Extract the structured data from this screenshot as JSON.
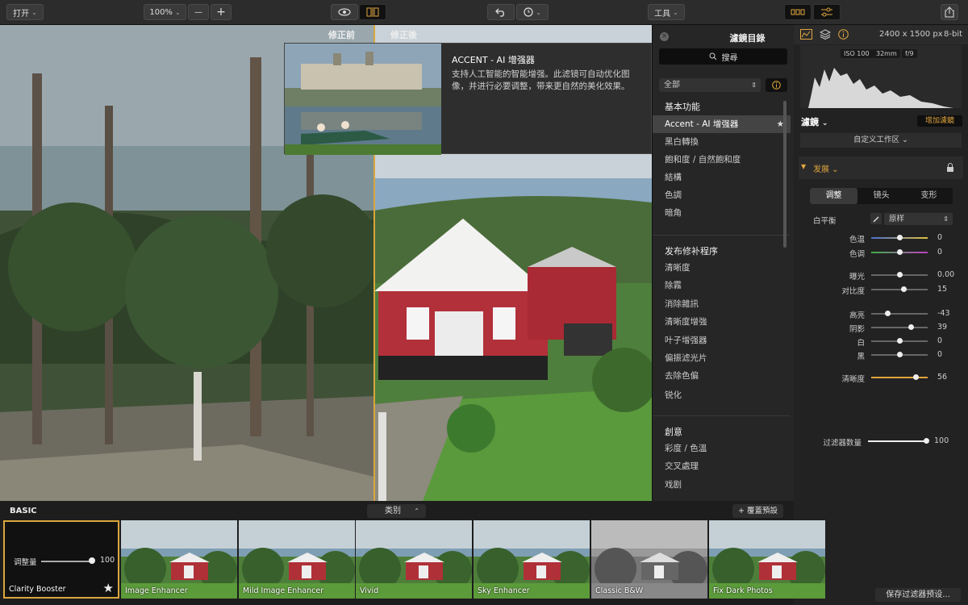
{
  "toolbar": {
    "open_label": "打开",
    "zoom_value": "100%",
    "minus_label": "—",
    "plus_label": "+",
    "tools_label": "工具"
  },
  "compare": {
    "before_label": "修正前",
    "after_label": "修正後"
  },
  "tooltip": {
    "title": "ACCENT - AI 增强器",
    "description": "支持人工智能的智能增强。此滤镜可自动优化图像，并进行必要调整，带来更自然的美化效果。"
  },
  "catalog": {
    "title": "濾鏡目錄",
    "search_placeholder": "搜尋",
    "filter_value": "全部",
    "sections": [
      {
        "title": "基本功能",
        "items": [
          "Accent - AI 增强器",
          "黑白轉換",
          "飽和度 / 自然飽和度",
          "結構",
          "色調",
          "暗角"
        ]
      },
      {
        "title": "发布修补程序",
        "items": [
          "清晰度",
          "除霧",
          "消除雜訊",
          "清晰度增強",
          "叶子增强器",
          "偏振滤光片",
          "去除色偏",
          "锐化"
        ]
      },
      {
        "title": "創意",
        "items": [
          "彩度 / 色溫",
          "交叉處理",
          "戏剧"
        ]
      }
    ]
  },
  "right_panel": {
    "dimensions": "2400 x 1500 px",
    "bit_depth": "8-bit",
    "exif": [
      "ISO 100",
      "32mm",
      "f/9"
    ],
    "filters_title": "濾鏡",
    "add_filter_label": "增加濾鏡",
    "workspace_label": "自定义工作区",
    "develop_title": "发展",
    "tabs": [
      "调整",
      "镜头",
      "变形"
    ],
    "white_balance_label": "白平衡",
    "white_balance_value": "原样",
    "sliders": [
      {
        "label": "色温",
        "value": "0",
        "level": 0.5
      },
      {
        "label": "色调",
        "value": "0",
        "level": 0.5
      },
      {
        "label": "曝光",
        "value": "0.00",
        "level": 0.5
      },
      {
        "label": "对比度",
        "value": "15",
        "level": 0.575
      },
      {
        "label": "高亮",
        "value": "-43",
        "level": 0.285
      },
      {
        "label": "阴影",
        "value": "39",
        "level": 0.695
      },
      {
        "label": "白",
        "value": "0",
        "level": 0.5
      },
      {
        "label": "黑",
        "value": "0",
        "level": 0.5
      },
      {
        "label": "清晰度",
        "value": "56",
        "level": 0.78
      }
    ],
    "filter_amount_label": "过滤器数量",
    "filter_amount_value": "100",
    "save_preset_label": "保存过滤器预设..."
  },
  "strip": {
    "category_label": "BASIC",
    "type_label": "类别",
    "add_preset_label": "+ 覆蓋預設",
    "selected_slider_label": "调整量",
    "selected_slider_value": "100",
    "presets": [
      "Clarity Booster",
      "Image Enhancer",
      "Mild Image Enhancer",
      "Vivid",
      "Sky Enhancer",
      "Classic B&W",
      "Fix Dark Photos"
    ]
  },
  "colors": {
    "accent": "#d9a63c",
    "panel": "#262626"
  }
}
